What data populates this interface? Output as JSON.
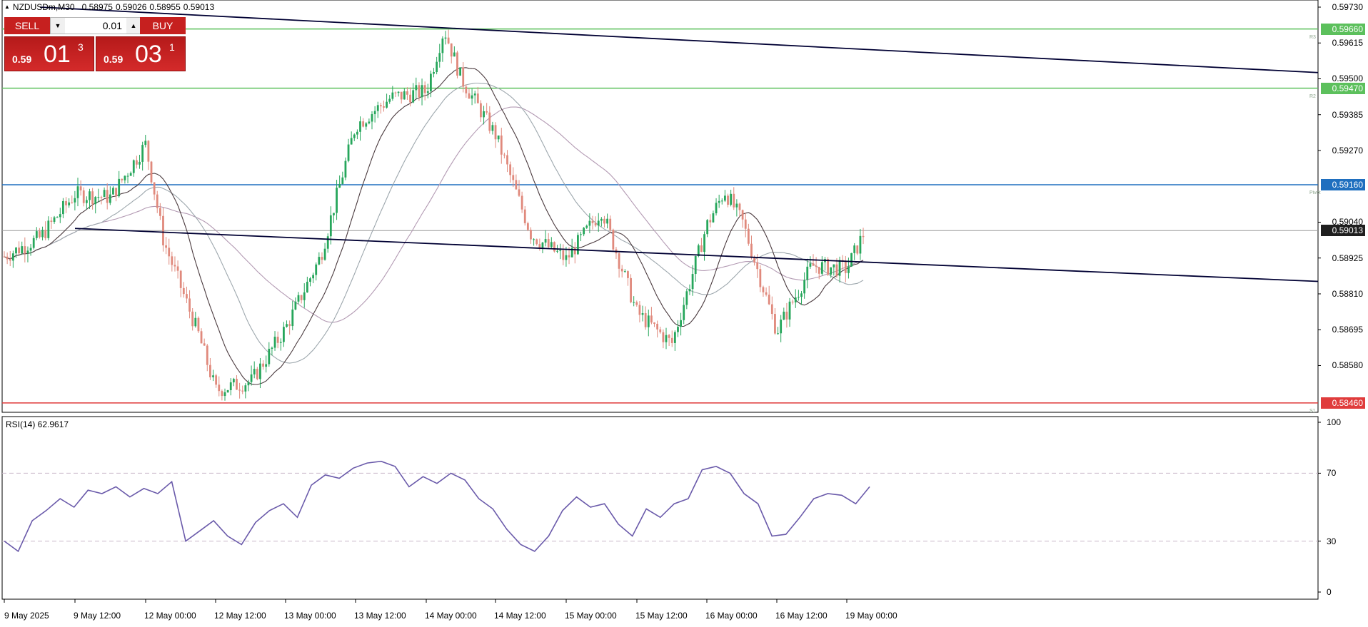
{
  "header": {
    "symbol": "NZDUSDm,M30",
    "open": "0.58975",
    "high": "0.59026",
    "low": "0.58955",
    "close": "0.59013"
  },
  "trade_panel": {
    "sell_label": "SELL",
    "buy_label": "BUY",
    "lot": "0.01",
    "sell_quote": {
      "prefix": "0.59",
      "big": "01",
      "sup": "3"
    },
    "buy_quote": {
      "prefix": "0.59",
      "big": "03",
      "sup": "1"
    }
  },
  "chart_data": [
    {
      "type": "candlestick",
      "symbol": "NZDUSDm",
      "timeframe": "M30",
      "ylim": [
        0.5843,
        0.5973
      ],
      "price_ticks": [
        "0.59730",
        "0.59615",
        "0.59500",
        "0.59385",
        "0.59270",
        "0.59040",
        "0.58925",
        "0.58810",
        "0.58695",
        "0.58580"
      ],
      "x_tick_labels": [
        "9 May 2025",
        "9 May 12:00",
        "12 May 00:00",
        "12 May 12:00",
        "13 May 00:00",
        "13 May 12:00",
        "14 May 00:00",
        "14 May 12:00",
        "15 May 00:00",
        "15 May 12:00",
        "16 May 00:00",
        "16 May 12:00",
        "19 May 00:00"
      ],
      "close_path": [
        [
          "9 May 2025",
          0.5893
        ],
        [
          "9 May 06:00",
          0.5899
        ],
        [
          "9 May 12:00",
          0.5913
        ],
        [
          "9 May 18:00",
          0.5912
        ],
        [
          "12 May 00:00",
          0.5929
        ],
        [
          "12 May 03:00",
          0.5898
        ],
        [
          "12 May 09:00",
          0.5868
        ],
        [
          "12 May 12:00",
          0.585
        ],
        [
          "12 May 18:00",
          0.5853
        ],
        [
          "13 May 00:00",
          0.587
        ],
        [
          "13 May 06:00",
          0.5893
        ],
        [
          "13 May 12:00",
          0.5935
        ],
        [
          "13 May 18:00",
          0.5944
        ],
        [
          "14 May 00:00",
          0.5946
        ],
        [
          "14 May 03:00",
          0.5966
        ],
        [
          "14 May 06:00",
          0.595
        ],
        [
          "14 May 12:00",
          0.5932
        ],
        [
          "14 May 18:00",
          0.59
        ],
        [
          "15 May 00:00",
          0.5892
        ],
        [
          "15 May 06:00",
          0.5908
        ],
        [
          "15 May 12:00",
          0.5875
        ],
        [
          "15 May 18:00",
          0.5865
        ],
        [
          "16 May 00:00",
          0.5903
        ],
        [
          "16 May 03:00",
          0.5914
        ],
        [
          "16 May 06:00",
          0.5904
        ],
        [
          "16 May 12:00",
          0.5869
        ],
        [
          "16 May 18:00",
          0.589
        ],
        [
          "19 May 00:00",
          0.5889
        ],
        [
          "19 May 03:00",
          0.5901
        ]
      ],
      "current_price": "0.59013",
      "levels": [
        {
          "name": "R3",
          "value": "0.59660",
          "color": "#5cc05c"
        },
        {
          "name": "R2",
          "value": "0.59470",
          "color": "#5cc05c"
        },
        {
          "name": "Pivot",
          "value": "0.59160",
          "color": "#1f6fbf"
        },
        {
          "name": "S1",
          "value": "0.58460",
          "color": "#e03c3c"
        }
      ],
      "trendlines": [
        {
          "from": [
            "9 May 06:00",
            0.5973
          ],
          "to": [
            "right edge",
            0.5952
          ],
          "color": "#000033"
        },
        {
          "from": [
            "9 May 12:00",
            0.5902
          ],
          "to": [
            "right edge",
            0.5885
          ],
          "color": "#000033"
        }
      ],
      "moving_averages": [
        {
          "color": "#b39ab3"
        },
        {
          "color": "#9da7ad"
        },
        {
          "color": "#4b3b3f"
        }
      ],
      "up_color": "#26a65b",
      "down_color": "#e0897c"
    },
    {
      "type": "line",
      "title": "RSI(14) 62.9617",
      "ylim": [
        0,
        100
      ],
      "y_ticks": [
        "100",
        "70",
        "30",
        "0"
      ],
      "levels": [
        30,
        70
      ],
      "values": [
        [
          0,
          30
        ],
        [
          1,
          24
        ],
        [
          2,
          42
        ],
        [
          3,
          48
        ],
        [
          4,
          55
        ],
        [
          5,
          50
        ],
        [
          6,
          60
        ],
        [
          7,
          58
        ],
        [
          8,
          62
        ],
        [
          9,
          56
        ],
        [
          10,
          61
        ],
        [
          11,
          58
        ],
        [
          12,
          65
        ],
        [
          13,
          30
        ],
        [
          14,
          36
        ],
        [
          15,
          42
        ],
        [
          16,
          33
        ],
        [
          17,
          28
        ],
        [
          18,
          41
        ],
        [
          19,
          48
        ],
        [
          20,
          52
        ],
        [
          21,
          44
        ],
        [
          22,
          63
        ],
        [
          23,
          69
        ],
        [
          24,
          67
        ],
        [
          25,
          73
        ],
        [
          26,
          76
        ],
        [
          27,
          77
        ],
        [
          28,
          74
        ],
        [
          29,
          62
        ],
        [
          30,
          68
        ],
        [
          31,
          64
        ],
        [
          32,
          70
        ],
        [
          33,
          66
        ],
        [
          34,
          55
        ],
        [
          35,
          49
        ],
        [
          36,
          37
        ],
        [
          37,
          28
        ],
        [
          38,
          24
        ],
        [
          39,
          33
        ],
        [
          40,
          48
        ],
        [
          41,
          56
        ],
        [
          42,
          50
        ],
        [
          43,
          52
        ],
        [
          44,
          40
        ],
        [
          45,
          33
        ],
        [
          46,
          49
        ],
        [
          47,
          44
        ],
        [
          48,
          52
        ],
        [
          49,
          55
        ],
        [
          50,
          72
        ],
        [
          51,
          74
        ],
        [
          52,
          70
        ],
        [
          53,
          58
        ],
        [
          54,
          52
        ],
        [
          55,
          33
        ],
        [
          56,
          34
        ],
        [
          57,
          44
        ],
        [
          58,
          55
        ],
        [
          59,
          58
        ],
        [
          60,
          57
        ],
        [
          61,
          52
        ],
        [
          62,
          62
        ]
      ],
      "line_color": "#6a5aaa"
    }
  ]
}
